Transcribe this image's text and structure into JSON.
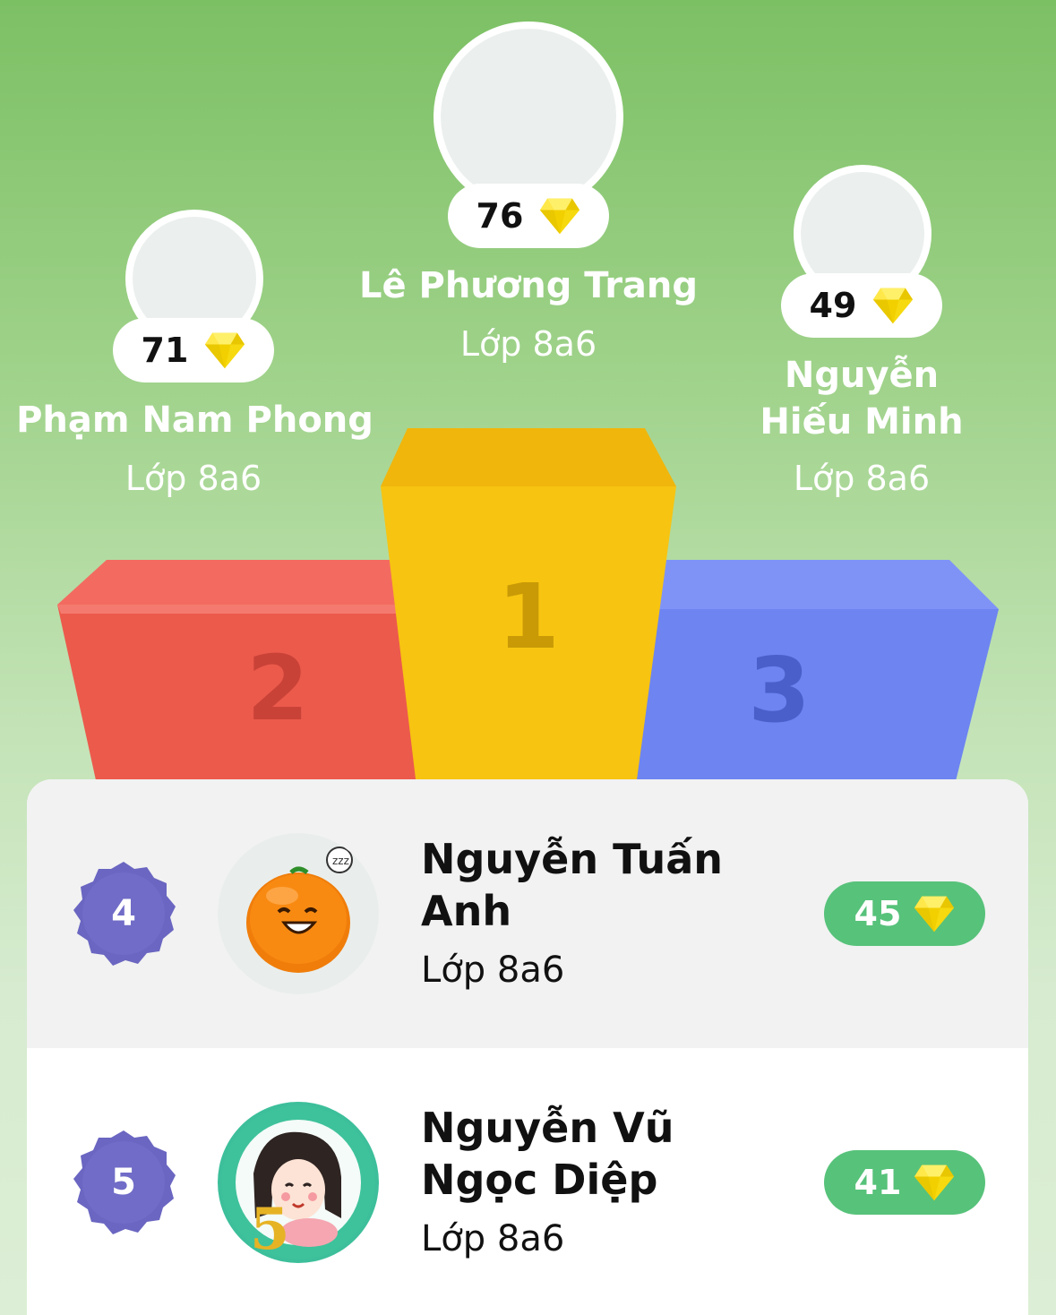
{
  "podium": {
    "first": {
      "rank": "1",
      "name": "Lê Phương Trang",
      "class": "Lớp 8a6",
      "score": "76"
    },
    "second": {
      "rank": "2",
      "name": "Phạm Nam Phong",
      "class": "Lớp 8a6",
      "score": "71"
    },
    "third": {
      "rank": "3",
      "name": "Nguyễn Hiếu Minh",
      "class": "Lớp 8a6",
      "score": "49"
    }
  },
  "list": [
    {
      "rank": "4",
      "name": "Nguyễn Tuấn Anh",
      "class": "Lớp 8a6",
      "score": "45",
      "avatar": "orange-mascot-avatar"
    },
    {
      "rank": "5",
      "name": "Nguyễn Vũ Ngọc Diệp",
      "class": "Lớp 8a6",
      "score": "41",
      "avatar": "birthday-girl-avatar"
    }
  ],
  "icons": {
    "gem": "diamond-gem-icon",
    "rank_badge": "badge-icon"
  },
  "colors": {
    "podium_first": "#f5bf10",
    "podium_second": "#ee5b4d",
    "podium_third": "#6f86f2",
    "score_green": "#57c27a",
    "badge_purple": "#6a66c1"
  }
}
